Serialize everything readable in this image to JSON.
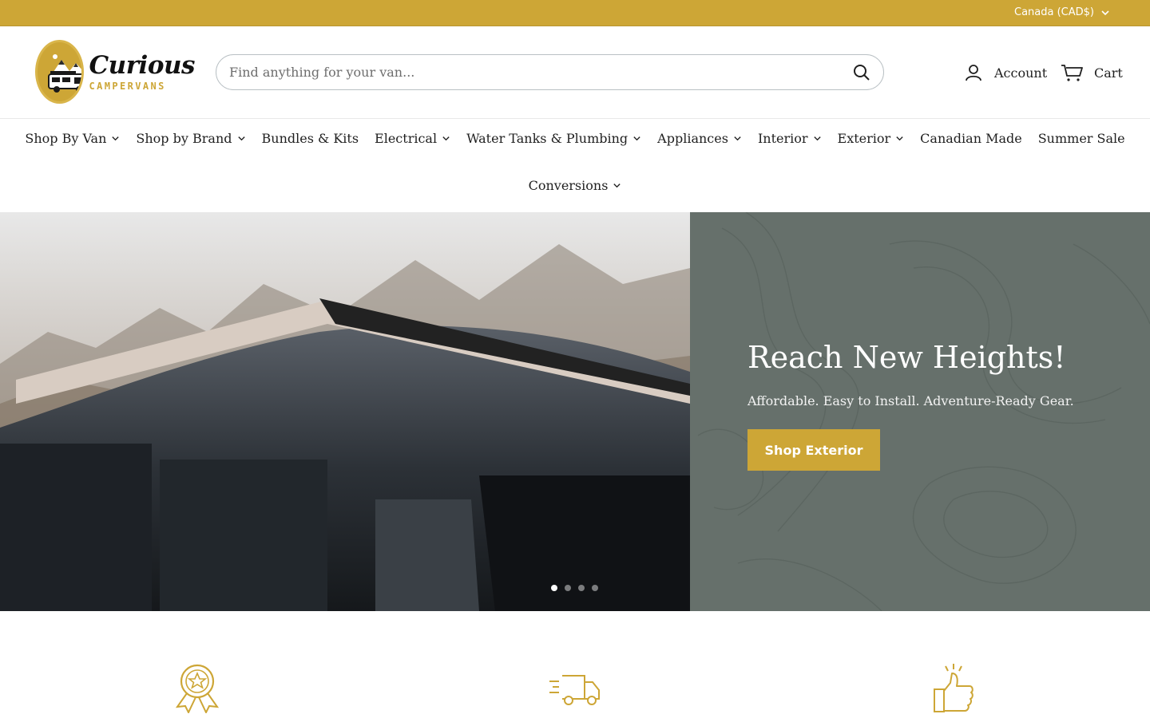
{
  "topbar": {
    "currency": "Canada (CAD$)"
  },
  "brand": {
    "name": "Curious",
    "sub": "CAMPERVANS",
    "color": "#cda636"
  },
  "search": {
    "placeholder": "Find anything for your van..."
  },
  "header": {
    "account": "Account",
    "cart": "Cart"
  },
  "nav": {
    "row1": [
      {
        "label": "Shop By Van",
        "dropdown": true
      },
      {
        "label": "Shop by Brand",
        "dropdown": true
      },
      {
        "label": "Bundles & Kits",
        "dropdown": false
      },
      {
        "label": "Electrical",
        "dropdown": true
      },
      {
        "label": "Water Tanks & Plumbing",
        "dropdown": true
      },
      {
        "label": "Appliances",
        "dropdown": true
      },
      {
        "label": "Interior",
        "dropdown": true
      },
      {
        "label": "Exterior",
        "dropdown": true
      },
      {
        "label": "Canadian Made",
        "dropdown": false
      },
      {
        "label": "Summer Sale",
        "dropdown": false
      }
    ],
    "row2": [
      {
        "label": "Conversions",
        "dropdown": true
      }
    ]
  },
  "hero": {
    "title": "Reach New Heights!",
    "subtitle": "Affordable. Easy to Install. Adventure-Ready Gear.",
    "cta": "Shop Exterior",
    "slide_count": 4,
    "active_slide": 1,
    "panel_color": "#66706b"
  },
  "features": {
    "icons": [
      "award-ribbon-icon",
      "delivery-truck-icon",
      "thumbs-up-icon"
    ]
  }
}
